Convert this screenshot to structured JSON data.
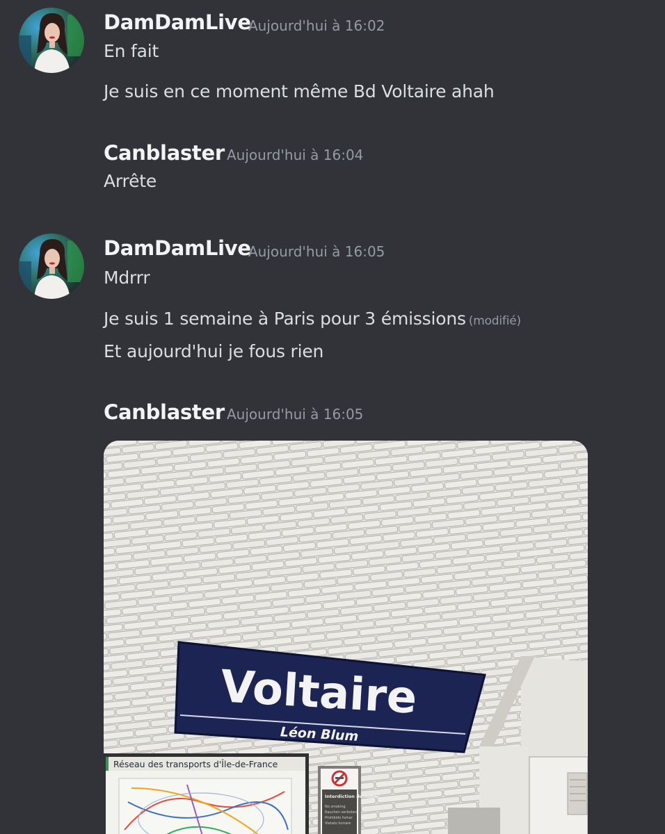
{
  "messages": [
    {
      "author": "DamDamLive",
      "timestamp": "Aujourd'hui à 16:02",
      "lines": [
        "En fait",
        "Je suis en ce moment même Bd Voltaire ahah"
      ]
    },
    {
      "author": "Canblaster",
      "timestamp": "Aujourd'hui à 16:04",
      "lines": [
        "Arrête"
      ]
    },
    {
      "author": "DamDamLive",
      "timestamp": "Aujourd'hui à 16:05",
      "lines": [
        "Mdrrr",
        "Je suis 1 semaine à Paris pour 3 émissions",
        "Et aujourd'hui je fous rien"
      ],
      "edited_label": "(modifié)"
    },
    {
      "author": "Canblaster",
      "timestamp": "Aujourd'hui à 16:05",
      "attachment": {
        "station_name": "Voltaire",
        "station_subtitle": "Léon Blum",
        "network_panel": "Réseau des transports d'Île-de-France",
        "no_smoking_title": "Interdiction de fumer",
        "no_smoking_lines": [
          "No smoking",
          "Rauchen verboten",
          "Prohibido fumar",
          "Vietato fumare"
        ]
      }
    }
  ],
  "colors": {
    "background": "#313338",
    "username": "#f2f3f5",
    "text": "#dbdee1",
    "muted": "#949ba4",
    "sign_blue": "#1b2452"
  }
}
